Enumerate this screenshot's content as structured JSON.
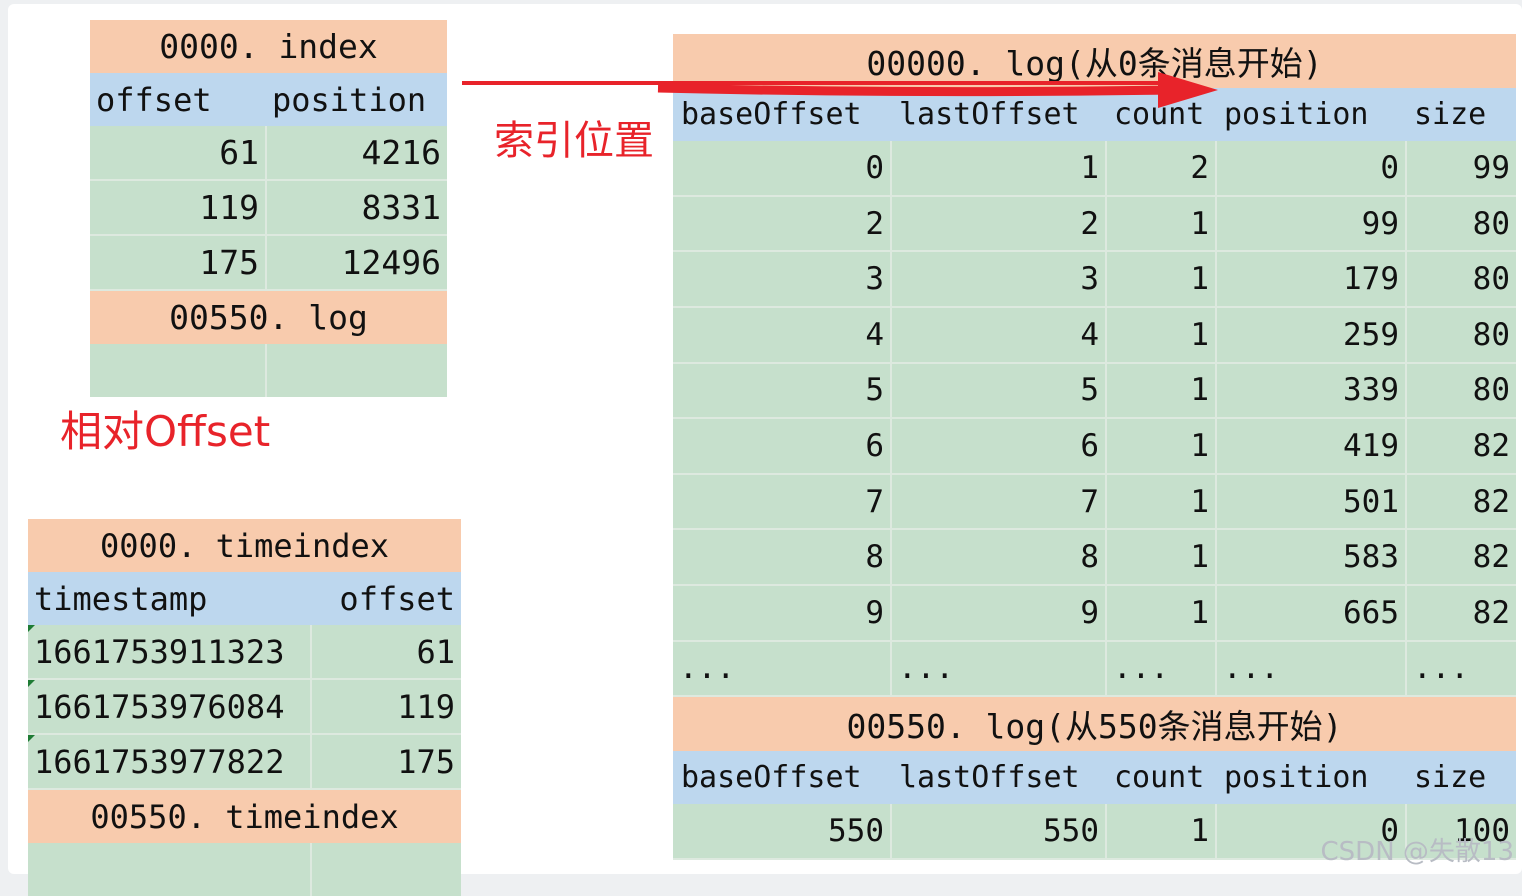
{
  "index_table": {
    "title": "0000. index",
    "headers": [
      "offset",
      "position"
    ],
    "rows": [
      [
        "61",
        "4216"
      ],
      [
        "119",
        "8331"
      ],
      [
        "175",
        "12496"
      ]
    ],
    "footer_title": "00550. log"
  },
  "timeindex_table": {
    "title": "0000. timeindex",
    "headers": [
      "timestamp",
      "offset"
    ],
    "rows": [
      [
        "1661753911323",
        "61"
      ],
      [
        "1661753976084",
        "119"
      ],
      [
        "1661753977822",
        "175"
      ]
    ],
    "footer_title": "00550. timeindex"
  },
  "log_table": {
    "title": "00000. log(从0条消息开始)",
    "headers": [
      "baseOffset",
      "lastOffset",
      "count",
      "position",
      "size"
    ],
    "rows": [
      [
        "0",
        "1",
        "2",
        "0",
        "99"
      ],
      [
        "2",
        "2",
        "1",
        "99",
        "80"
      ],
      [
        "3",
        "3",
        "1",
        "179",
        "80"
      ],
      [
        "4",
        "4",
        "1",
        "259",
        "80"
      ],
      [
        "5",
        "5",
        "1",
        "339",
        "80"
      ],
      [
        "6",
        "6",
        "1",
        "419",
        "82"
      ],
      [
        "7",
        "7",
        "1",
        "501",
        "82"
      ],
      [
        "8",
        "8",
        "1",
        "583",
        "82"
      ],
      [
        "9",
        "9",
        "1",
        "665",
        "82"
      ]
    ],
    "ellipsis": [
      "...",
      "...",
      "...",
      "...",
      "..."
    ],
    "second_title": "00550. log(从550条消息开始)",
    "second_headers": [
      "baseOffset",
      "lastOffset",
      "count",
      "position",
      "size"
    ],
    "second_rows": [
      [
        "550",
        "550",
        "1",
        "0",
        "100"
      ]
    ]
  },
  "annotations": {
    "index_position": "索引位置",
    "relative_offset": "相对Offset"
  },
  "watermark": "CSDN @失散13",
  "colors": {
    "title_bg": "#f8cbad",
    "header_bg": "#bdd7ee",
    "cell_bg": "#c6e0cc",
    "annotation": "#e8232a"
  }
}
